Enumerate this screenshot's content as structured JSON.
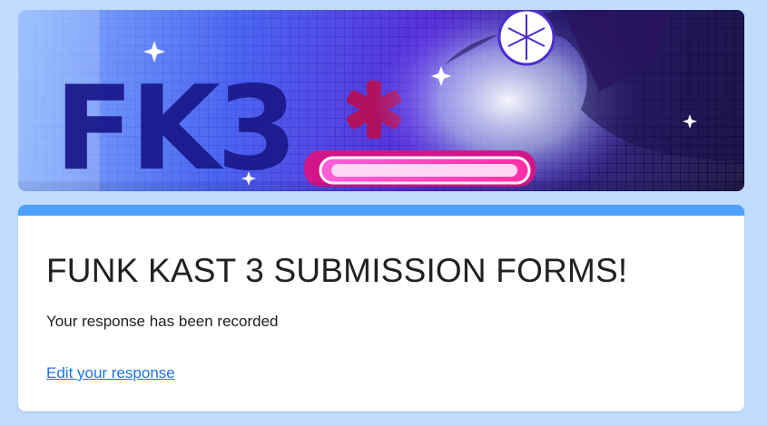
{
  "banner": {
    "logo_text": "FK3"
  },
  "form": {
    "title": "FUNK KAST 3 SUBMISSION FORMS!",
    "message": "Your response has been recorded",
    "edit_link": "Edit your response"
  },
  "colors": {
    "background": "#bfdcff",
    "accent": "#4ea1ff",
    "link": "#1a73e8"
  }
}
